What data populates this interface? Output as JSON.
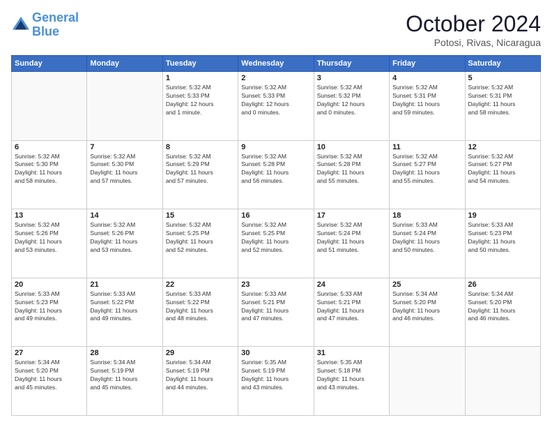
{
  "header": {
    "logo_line1": "General",
    "logo_line2": "Blue",
    "month_title": "October 2024",
    "location": "Potosi, Rivas, Nicaragua"
  },
  "days_of_week": [
    "Sunday",
    "Monday",
    "Tuesday",
    "Wednesday",
    "Thursday",
    "Friday",
    "Saturday"
  ],
  "weeks": [
    [
      {
        "day": "",
        "info": ""
      },
      {
        "day": "",
        "info": ""
      },
      {
        "day": "1",
        "info": "Sunrise: 5:32 AM\nSunset: 5:33 PM\nDaylight: 12 hours\nand 1 minute."
      },
      {
        "day": "2",
        "info": "Sunrise: 5:32 AM\nSunset: 5:33 PM\nDaylight: 12 hours\nand 0 minutes."
      },
      {
        "day": "3",
        "info": "Sunrise: 5:32 AM\nSunset: 5:32 PM\nDaylight: 12 hours\nand 0 minutes."
      },
      {
        "day": "4",
        "info": "Sunrise: 5:32 AM\nSunset: 5:31 PM\nDaylight: 11 hours\nand 59 minutes."
      },
      {
        "day": "5",
        "info": "Sunrise: 5:32 AM\nSunset: 5:31 PM\nDaylight: 11 hours\nand 58 minutes."
      }
    ],
    [
      {
        "day": "6",
        "info": "Sunrise: 5:32 AM\nSunset: 5:30 PM\nDaylight: 11 hours\nand 58 minutes."
      },
      {
        "day": "7",
        "info": "Sunrise: 5:32 AM\nSunset: 5:30 PM\nDaylight: 11 hours\nand 57 minutes."
      },
      {
        "day": "8",
        "info": "Sunrise: 5:32 AM\nSunset: 5:29 PM\nDaylight: 11 hours\nand 57 minutes."
      },
      {
        "day": "9",
        "info": "Sunrise: 5:32 AM\nSunset: 5:28 PM\nDaylight: 11 hours\nand 56 minutes."
      },
      {
        "day": "10",
        "info": "Sunrise: 5:32 AM\nSunset: 5:28 PM\nDaylight: 11 hours\nand 55 minutes."
      },
      {
        "day": "11",
        "info": "Sunrise: 5:32 AM\nSunset: 5:27 PM\nDaylight: 11 hours\nand 55 minutes."
      },
      {
        "day": "12",
        "info": "Sunrise: 5:32 AM\nSunset: 5:27 PM\nDaylight: 11 hours\nand 54 minutes."
      }
    ],
    [
      {
        "day": "13",
        "info": "Sunrise: 5:32 AM\nSunset: 5:26 PM\nDaylight: 11 hours\nand 53 minutes."
      },
      {
        "day": "14",
        "info": "Sunrise: 5:32 AM\nSunset: 5:26 PM\nDaylight: 11 hours\nand 53 minutes."
      },
      {
        "day": "15",
        "info": "Sunrise: 5:32 AM\nSunset: 5:25 PM\nDaylight: 11 hours\nand 52 minutes."
      },
      {
        "day": "16",
        "info": "Sunrise: 5:32 AM\nSunset: 5:25 PM\nDaylight: 11 hours\nand 52 minutes."
      },
      {
        "day": "17",
        "info": "Sunrise: 5:32 AM\nSunset: 5:24 PM\nDaylight: 11 hours\nand 51 minutes."
      },
      {
        "day": "18",
        "info": "Sunrise: 5:33 AM\nSunset: 5:24 PM\nDaylight: 11 hours\nand 50 minutes."
      },
      {
        "day": "19",
        "info": "Sunrise: 5:33 AM\nSunset: 5:23 PM\nDaylight: 11 hours\nand 50 minutes."
      }
    ],
    [
      {
        "day": "20",
        "info": "Sunrise: 5:33 AM\nSunset: 5:23 PM\nDaylight: 11 hours\nand 49 minutes."
      },
      {
        "day": "21",
        "info": "Sunrise: 5:33 AM\nSunset: 5:22 PM\nDaylight: 11 hours\nand 49 minutes."
      },
      {
        "day": "22",
        "info": "Sunrise: 5:33 AM\nSunset: 5:22 PM\nDaylight: 11 hours\nand 48 minutes."
      },
      {
        "day": "23",
        "info": "Sunrise: 5:33 AM\nSunset: 5:21 PM\nDaylight: 11 hours\nand 47 minutes."
      },
      {
        "day": "24",
        "info": "Sunrise: 5:33 AM\nSunset: 5:21 PM\nDaylight: 11 hours\nand 47 minutes."
      },
      {
        "day": "25",
        "info": "Sunrise: 5:34 AM\nSunset: 5:20 PM\nDaylight: 11 hours\nand 46 minutes."
      },
      {
        "day": "26",
        "info": "Sunrise: 5:34 AM\nSunset: 5:20 PM\nDaylight: 11 hours\nand 46 minutes."
      }
    ],
    [
      {
        "day": "27",
        "info": "Sunrise: 5:34 AM\nSunset: 5:20 PM\nDaylight: 11 hours\nand 45 minutes."
      },
      {
        "day": "28",
        "info": "Sunrise: 5:34 AM\nSunset: 5:19 PM\nDaylight: 11 hours\nand 45 minutes."
      },
      {
        "day": "29",
        "info": "Sunrise: 5:34 AM\nSunset: 5:19 PM\nDaylight: 11 hours\nand 44 minutes."
      },
      {
        "day": "30",
        "info": "Sunrise: 5:35 AM\nSunset: 5:19 PM\nDaylight: 11 hours\nand 43 minutes."
      },
      {
        "day": "31",
        "info": "Sunrise: 5:35 AM\nSunset: 5:18 PM\nDaylight: 11 hours\nand 43 minutes."
      },
      {
        "day": "",
        "info": ""
      },
      {
        "day": "",
        "info": ""
      }
    ]
  ]
}
